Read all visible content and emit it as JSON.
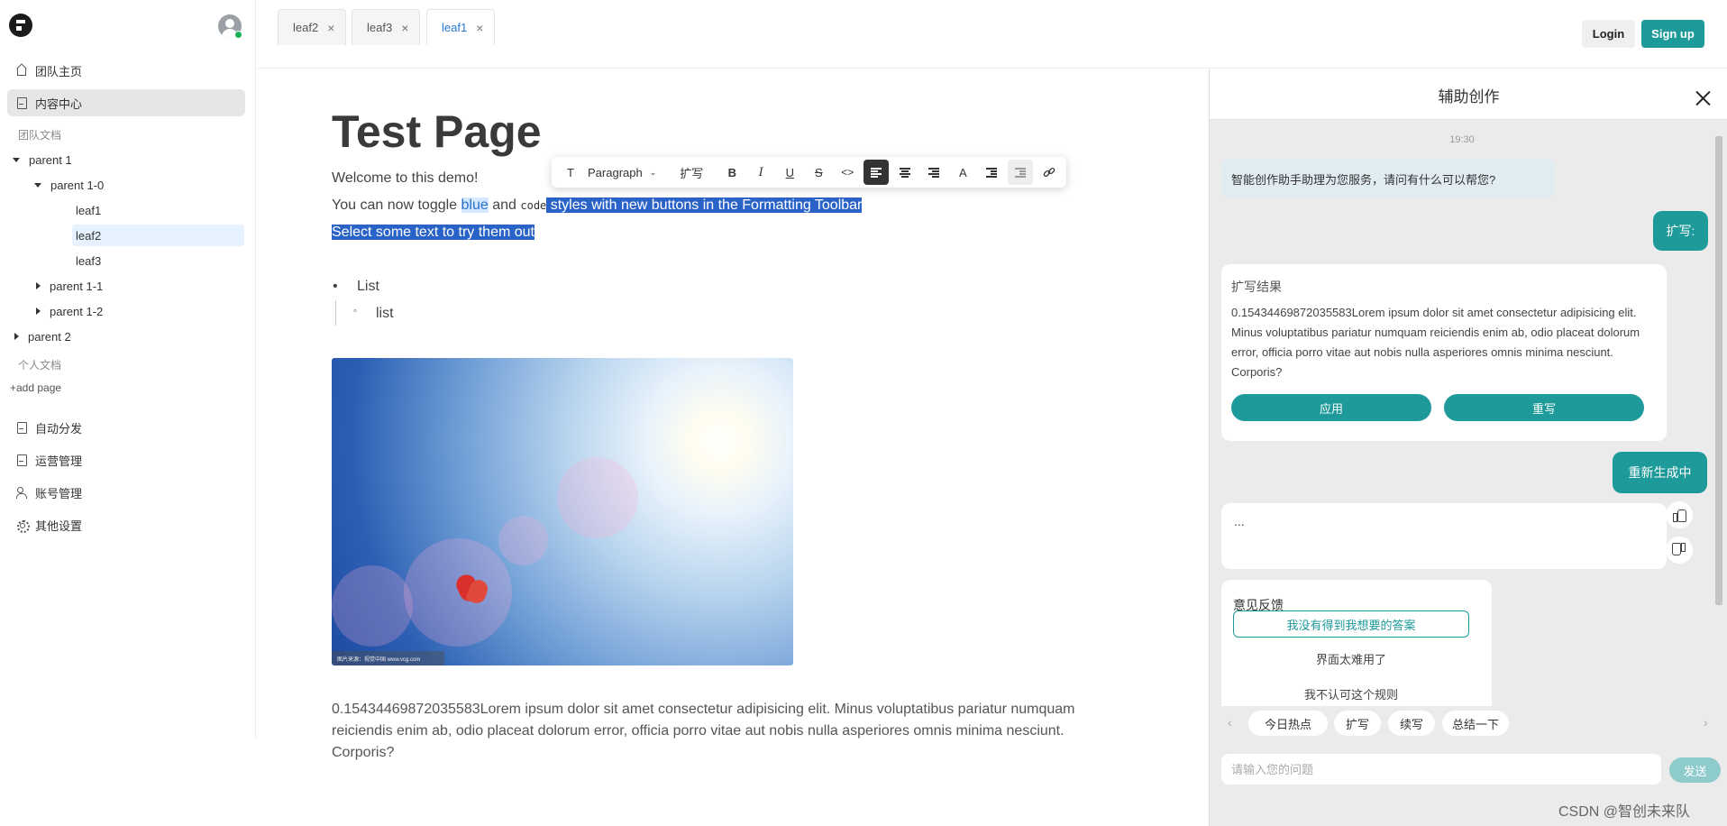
{
  "sidebar": {
    "nav_top": [
      {
        "label": "团队主页",
        "icon": "home-icon"
      },
      {
        "label": "内容中心",
        "icon": "document-icon",
        "active": true
      }
    ],
    "team_docs_label": "团队文档",
    "tree": [
      {
        "label": "parent 1",
        "expanded": true
      },
      {
        "label": "parent 1-0",
        "expanded": true
      },
      {
        "label": "leaf1"
      },
      {
        "label": "leaf2",
        "selected": true
      },
      {
        "label": "leaf3"
      },
      {
        "label": "parent 1-1",
        "expanded": false
      },
      {
        "label": "parent 1-2",
        "expanded": false
      },
      {
        "label": "parent 2",
        "expanded": false
      }
    ],
    "personal_docs_label": "个人文档",
    "add_page_label": "+add page",
    "nav_bottom": [
      {
        "label": "自动分发",
        "icon": "document-icon"
      },
      {
        "label": "运营管理",
        "icon": "document-icon"
      },
      {
        "label": "账号管理",
        "icon": "users-icon"
      },
      {
        "label": "其他设置",
        "icon": "gear-icon"
      }
    ]
  },
  "tabs": [
    {
      "label": "leaf2",
      "active": false
    },
    {
      "label": "leaf3",
      "active": false
    },
    {
      "label": "leaf1",
      "active": true
    }
  ],
  "auth": {
    "login_label": "Login",
    "signup_label": "Sign up"
  },
  "editor": {
    "title": "Test Page",
    "line1": "Welcome to this demo!",
    "line2": {
      "t1": "You can now toggle ",
      "blue": "blue",
      "t2": " and ",
      "code": "code",
      "selected": " styles with new buttons in the Formatting Toolbar "
    },
    "line3_selected": "Select some text to try them out",
    "list_item": "List",
    "sub_list_item": "list",
    "image_caption": "图片来源：视觉中国 www.vcg.com",
    "body_text": "0.15434469872035583Lorem ipsum dolor sit amet consectetur adipisicing elit. Minus voluptatibus pariatur numquam reiciendis enim ab, odio placeat dolorum error, officia porro vitae aut nobis nulla asperiores omnis minima nesciunt. Corporis?"
  },
  "toolbar": {
    "block_type": "Paragraph",
    "expand_label": "扩写",
    "bold": "B",
    "italic": "I",
    "underline": "U",
    "strike": "S",
    "code": "<>",
    "text_color": "A"
  },
  "assistant": {
    "title": "辅助创作",
    "time": "19:30",
    "greeting": "智能创作助手助理为您服务，请问有什么可以帮您?",
    "user_msg_1": "扩写:",
    "result_card": {
      "title": "扩写结果",
      "text": "0.15434469872035583Lorem ipsum dolor sit amet consectetur adipisicing elit. Minus voluptatibus pariatur numquam reiciendis enim ab, odio placeat dolorum error, officia porro vitae aut nobis nulla asperiores omnis minima nesciunt. Corporis?",
      "apply_label": "应用",
      "rewrite_label": "重写"
    },
    "user_msg_2": "重新生成中",
    "loading_text": "...",
    "feedback": {
      "title": "意见反馈",
      "options": [
        "我没有得到我想要的答案",
        "界面太难用了",
        "我不认可这个规则"
      ]
    },
    "quick_actions": [
      "今日热点",
      "扩写",
      "续写",
      "总结一下"
    ],
    "input_placeholder": "请输入您的问题",
    "send_label": "发送"
  },
  "watermark": "CSDN @智创未来队",
  "colors": {
    "accent": "#1e9a9a",
    "selection": "#2a63c7",
    "link_blue": "#2878d6"
  }
}
